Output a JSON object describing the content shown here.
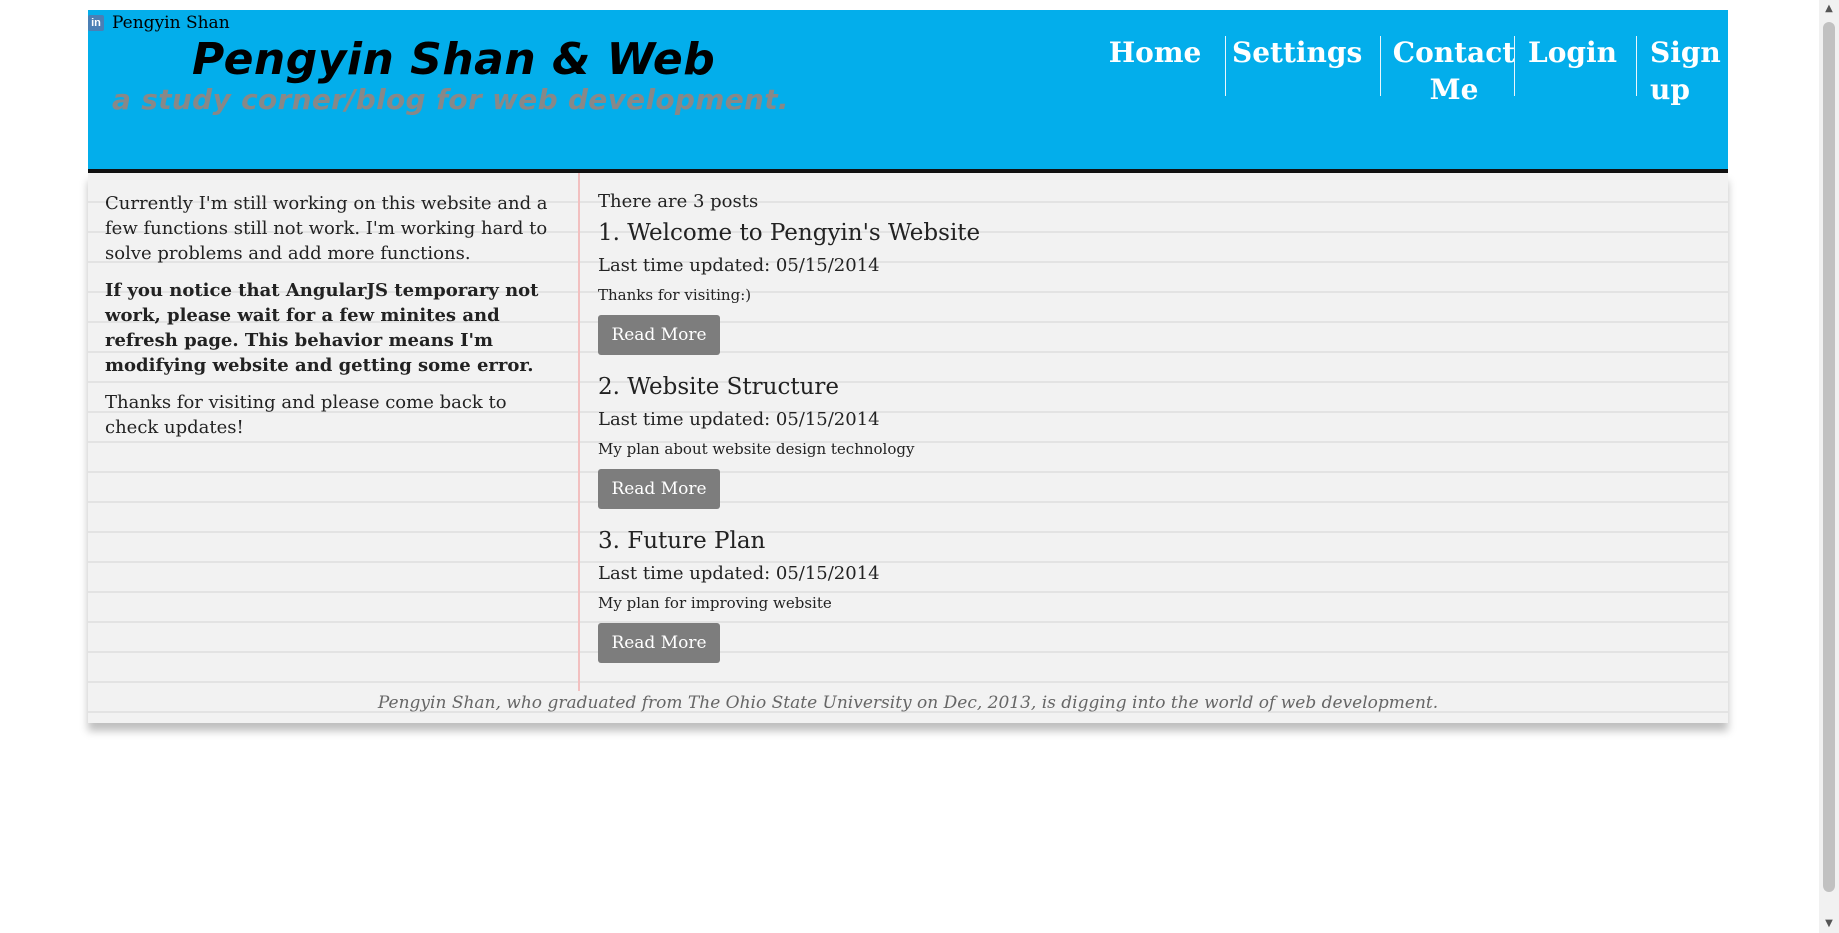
{
  "linkedin": {
    "icon": "linkedin-icon",
    "icon_text": "in",
    "label": "Pengyin Shan"
  },
  "header": {
    "title": "Pengyin Shan & Web",
    "tagline": "a study corner/blog for web development.",
    "background_color": "#03aeeb",
    "nav": [
      {
        "label": "Home"
      },
      {
        "label": "Settings"
      },
      {
        "label": "Contact Me"
      },
      {
        "label": "Login"
      },
      {
        "label": "Sign up"
      }
    ]
  },
  "sidebar": {
    "notice": "Currently I'm still working on this website and a few functions still not work. I'm working hard to solve problems and add more functions.",
    "warning": "If you notice that AngularJS temporary not work, please wait for a few minites and refresh page. This behavior means I'm modifying website and getting some error.",
    "thanks": "Thanks for visiting and please come back to check updates!"
  },
  "posts": {
    "count_text": "There are 3 posts",
    "items": [
      {
        "title": "1. Welcome to Pengyin's Website",
        "updated": "Last time updated: 05/15/2014",
        "summary": "Thanks for visiting:)",
        "button": "Read More"
      },
      {
        "title": "2. Website Structure",
        "updated": "Last time updated: 05/15/2014",
        "summary": "My plan about website design technology",
        "button": "Read More"
      },
      {
        "title": "3. Future Plan",
        "updated": "Last time updated: 05/15/2014",
        "summary": "My plan for improving website",
        "button": "Read More"
      }
    ]
  },
  "footer": {
    "text": "Pengyin Shan, who graduated from The Ohio State University on Dec, 2013, is digging into the world of web development."
  },
  "scrollbar": {
    "up_icon": "chevron-up-icon",
    "down_icon": "chevron-down-icon"
  }
}
